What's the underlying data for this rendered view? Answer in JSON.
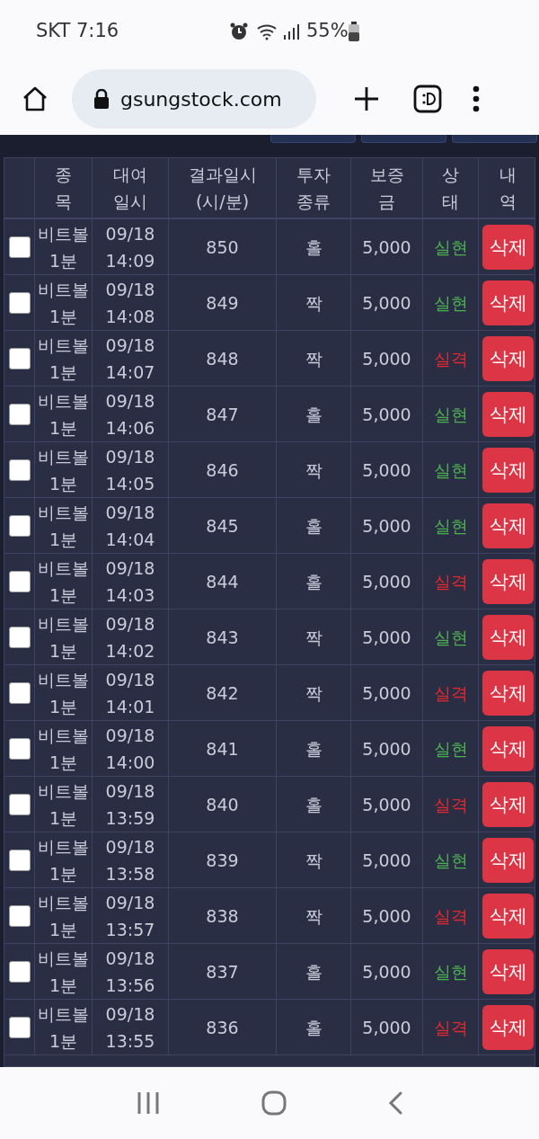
{
  "status_bar": {
    "carrier_time": "SKT 7:16",
    "battery": "55%"
  },
  "browser": {
    "url": "gsungstock.com"
  },
  "table": {
    "columns": [
      "종목",
      "대여일시",
      "결과일시 (시/분)",
      "투자종류",
      "보증금",
      "상태",
      "내역"
    ],
    "rows": [
      {
        "checked": false,
        "item": "비트볼 1분",
        "date": "09/18 14:09",
        "result_time": "850",
        "type": "홀",
        "deposit": "5,000",
        "status": "실현",
        "color": "#4caf50",
        "action": "삭제"
      },
      {
        "checked": false,
        "item": "비트볼 1분",
        "date": "09/18 14:08",
        "result_time": "849",
        "type": "짝",
        "deposit": "5,000",
        "status": "실현",
        "color": "#4caf50",
        "action": "삭제"
      },
      {
        "checked": false,
        "item": "비트볼 1분",
        "date": "09/18 14:07",
        "result_time": "848",
        "type": "짝",
        "deposit": "5,000",
        "status": "실격",
        "color": "#e0282e",
        "action": "삭제"
      },
      {
        "checked": false,
        "item": "비트볼 1분",
        "date": "09/18 14:06",
        "result_time": "847",
        "type": "홀",
        "deposit": "5,000",
        "status": "실현",
        "color": "#4caf50",
        "action": "삭제"
      },
      {
        "checked": false,
        "item": "비트볼 1분",
        "date": "09/18 14:05",
        "result_time": "846",
        "type": "짝",
        "deposit": "5,000",
        "status": "실현",
        "color": "#4caf50",
        "action": "삭제"
      },
      {
        "checked": false,
        "item": "비트볼 1분",
        "date": "09/18 14:04",
        "result_time": "845",
        "type": "홀",
        "deposit": "5,000",
        "status": "실현",
        "color": "#4caf50",
        "action": "삭제"
      },
      {
        "checked": false,
        "item": "비트볼 1분",
        "date": "09/18 14:03",
        "result_time": "844",
        "type": "홀",
        "deposit": "5,000",
        "status": "실격",
        "color": "#e0282e",
        "action": "삭제"
      },
      {
        "checked": false,
        "item": "비트볼 1분",
        "date": "09/18 14:02",
        "result_time": "843",
        "type": "짝",
        "deposit": "5,000",
        "status": "실현",
        "color": "#4caf50",
        "action": "삭제"
      },
      {
        "checked": false,
        "item": "비트볼 1분",
        "date": "09/18 14:01",
        "result_time": "842",
        "type": "짝",
        "deposit": "5,000",
        "status": "실격",
        "color": "#e0282e",
        "action": "삭제"
      },
      {
        "checked": false,
        "item": "비트볼 1분",
        "date": "09/18 14:00",
        "result_time": "841",
        "type": "홀",
        "deposit": "5,000",
        "status": "실현",
        "color": "#4caf50",
        "action": "삭제"
      },
      {
        "checked": false,
        "item": "비트볼 1분",
        "date": "09/18 13:59",
        "result_time": "840",
        "type": "홀",
        "deposit": "5,000",
        "status": "실격",
        "color": "#e0282e",
        "action": "삭제"
      },
      {
        "checked": false,
        "item": "비트볼 1분",
        "date": "09/18 13:58",
        "result_time": "839",
        "type": "짝",
        "deposit": "5,000",
        "status": "실현",
        "color": "#4caf50",
        "action": "삭제"
      },
      {
        "checked": false,
        "item": "비트볼 1분",
        "date": "09/18 13:57",
        "result_time": "838",
        "type": "짝",
        "deposit": "5,000",
        "status": "실격",
        "color": "#e0282e",
        "action": "삭제"
      },
      {
        "checked": false,
        "item": "비트볼 1분",
        "date": "09/18 13:56",
        "result_time": "837",
        "type": "홀",
        "deposit": "5,000",
        "status": "실현",
        "color": "#4caf50",
        "action": "삭제"
      },
      {
        "checked": false,
        "item": "비트볼 1분",
        "date": "09/18 13:55",
        "result_time": "836",
        "type": "홀",
        "deposit": "5,000",
        "status": "실격",
        "color": "#e0282e",
        "action": "삭제"
      }
    ]
  }
}
